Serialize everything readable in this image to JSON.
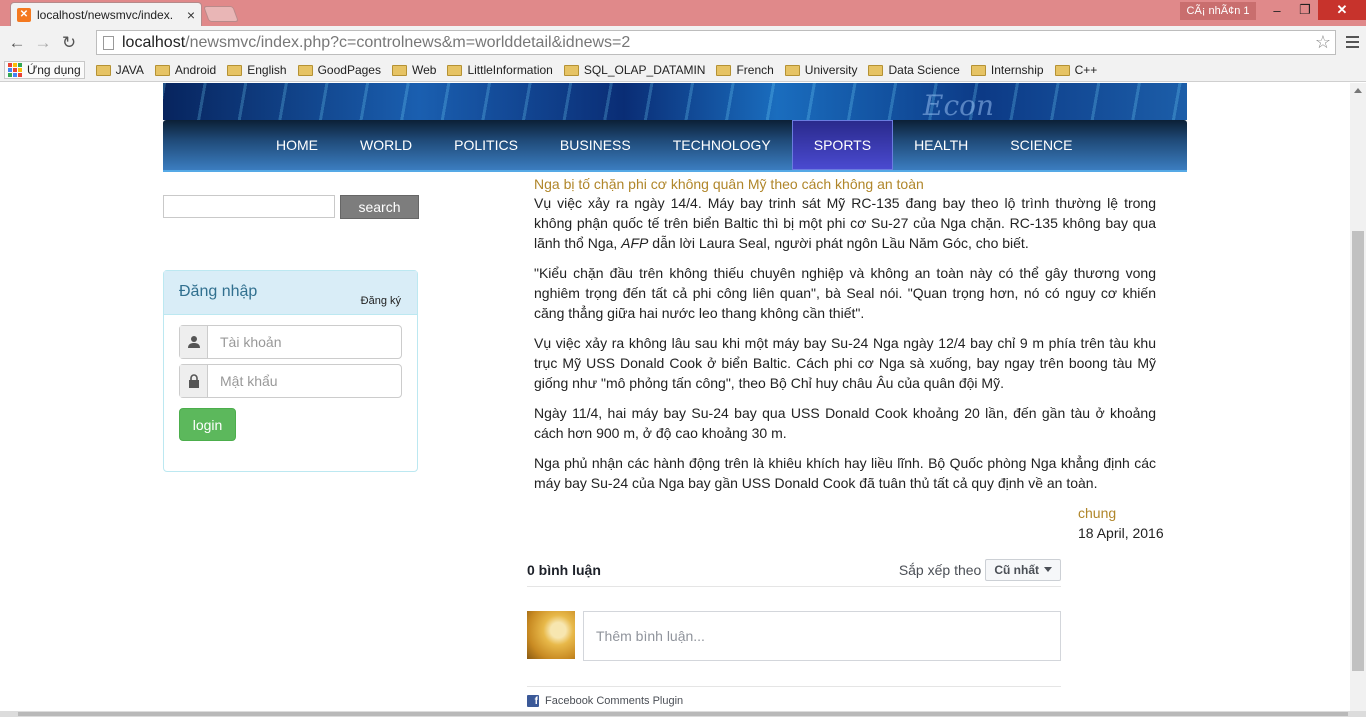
{
  "browser": {
    "tab_title": "localhost/newsmvc/index.",
    "profile": "CÃ¡ nhÃ¢n 1",
    "url_host": "localhost",
    "url_path": "/newsmvc/index.php?c=controlnews&m=worlddetail&idnews=2",
    "bookmarks": [
      "Ứng dụng",
      "JAVA",
      "Android",
      "English",
      "GoodPages",
      "Web",
      "LittleInformation",
      "SQL_OLAP_DATAMIN",
      "French",
      "University",
      "Data Science",
      "Internship",
      "C++"
    ]
  },
  "site": {
    "menu": [
      "HOME",
      "WORLD",
      "POLITICS",
      "BUSINESS",
      "TECHNOLOGY",
      "SPORTS",
      "HEALTH",
      "SCIENCE"
    ],
    "active_menu": "SPORTS",
    "banner_text": "Econ",
    "search_button": "search",
    "login": {
      "title": "Đăng nhập",
      "register": "Đăng ký",
      "username_placeholder": "Tài khoản",
      "password_placeholder": "Mật khẩu",
      "button": "login"
    }
  },
  "article": {
    "title": "Nga bị tố chặn phi cơ không quân Mỹ theo cách không an toàn",
    "p1a": "Vụ việc xảy ra ngày 14/4. Máy bay trinh sát Mỹ RC-135 đang bay theo lộ trình thường lệ trong không phận quốc tế trên biển Baltic thì bị một phi cơ Su-27 của Nga chặn. RC-135 không bay qua lãnh thổ Nga, ",
    "p1_source": "AFP",
    "p1b": " dẫn lời Laura Seal, người phát ngôn Lầu Năm Góc, cho biết.",
    "p2": "\"Kiểu chặn đầu trên không thiếu chuyên nghiệp và không an toàn này có thể gây thương vong nghiêm trọng đến tất cả phi công liên quan\", bà Seal nói. \"Quan trọng hơn, nó có nguy cơ khiến căng thẳng giữa hai nước leo thang không cần thiết\".",
    "p3": "Vụ việc xảy ra không lâu sau khi một máy bay Su-24 Nga ngày 12/4 bay chỉ 9 m phía trên tàu khu trục Mỹ USS Donald Cook ở biển Baltic. Cách phi cơ Nga sà xuống, bay ngay trên boong tàu Mỹ giống như \"mô phỏng tấn công\", theo Bộ Chỉ huy châu Âu của quân đội Mỹ.",
    "p4": "Ngày 11/4, hai máy bay Su-24 bay qua USS Donald Cook khoảng 20 lần, đến gần tàu ở khoảng cách hơn 900 m, ở độ cao khoảng 30 m.",
    "p5": "Nga phủ nhận các hành động trên là khiêu khích hay liều lĩnh. Bộ Quốc phòng Nga khẳng định các máy bay Su-24 của Nga bay gần USS Donald Cook đã tuân thủ tất cả quy định về an toàn.",
    "author": "chung",
    "date": "18 April, 2016"
  },
  "comments": {
    "count_label": "0 bình luận",
    "sort_label": "Sắp xếp theo",
    "sort_value": "Cũ nhất",
    "placeholder": "Thêm bình luận...",
    "plugin_label": "Facebook Comments Plugin"
  },
  "colors": {
    "accent": "#b0862a",
    "login_green": "#5cb85c",
    "menu_active": "#3a3ab0"
  }
}
